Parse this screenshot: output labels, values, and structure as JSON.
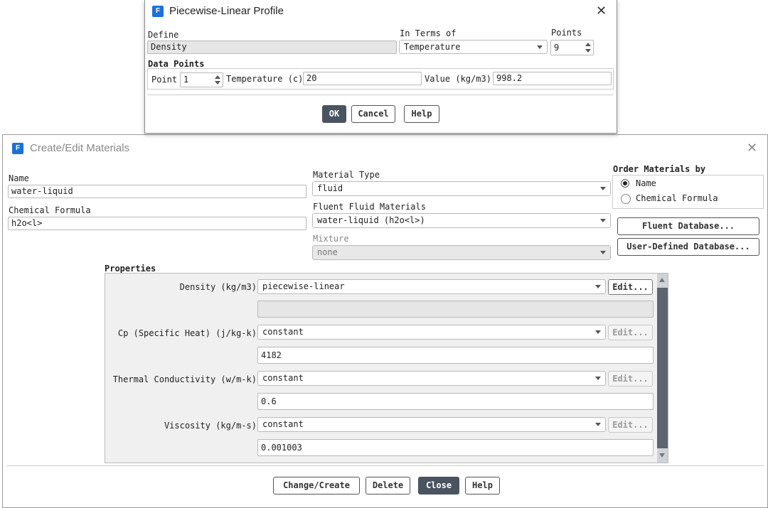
{
  "pwl": {
    "title": "Piecewise-Linear Profile",
    "define_label": "Define",
    "define_value": "Density",
    "interms_label": "In Terms of",
    "interms_value": "Temperature",
    "points_label": "Points",
    "points_value": "9",
    "datapoints_label": "Data Points",
    "point_label": "Point",
    "point_value": "1",
    "temp_label": "Temperature (c)",
    "temp_value": "20",
    "value_label": "Value (kg/m3)",
    "value_value": "998.2",
    "ok": "OK",
    "cancel": "Cancel",
    "help": "Help"
  },
  "mat": {
    "title": "Create/Edit Materials",
    "name_label": "Name",
    "name_value": "water-liquid",
    "formula_label": "Chemical Formula",
    "formula_value": "h2o<l>",
    "type_label": "Material Type",
    "type_value": "fluid",
    "fluent_label": "Fluent Fluid Materials",
    "fluent_value": "water-liquid (h2o<l>)",
    "mixture_label": "Mixture",
    "mixture_value": "none",
    "order_label": "Order Materials by",
    "order_name": "Name",
    "order_formula": "Chemical Formula",
    "fluent_db": "Fluent Database...",
    "user_db": "User-Defined Database...",
    "properties_label": "Properties",
    "props": [
      {
        "label": "Density (kg/m3)",
        "method": "piecewise-linear",
        "value": "",
        "edit": "Edit..."
      },
      {
        "label": "Cp (Specific Heat) (j/kg-k)",
        "method": "constant",
        "value": "4182",
        "edit": "Edit..."
      },
      {
        "label": "Thermal Conductivity (w/m-k)",
        "method": "constant",
        "value": "0.6",
        "edit": "Edit..."
      },
      {
        "label": "Viscosity (kg/m-s)",
        "method": "constant",
        "value": "0.001003",
        "edit": "Edit..."
      }
    ],
    "change_create": "Change/Create",
    "delete": "Delete",
    "close": "Close",
    "help": "Help"
  },
  "colors": {
    "accent": "#1e6fd9",
    "dark_button": "#4a5460",
    "scrollbar": "#5b6570"
  }
}
